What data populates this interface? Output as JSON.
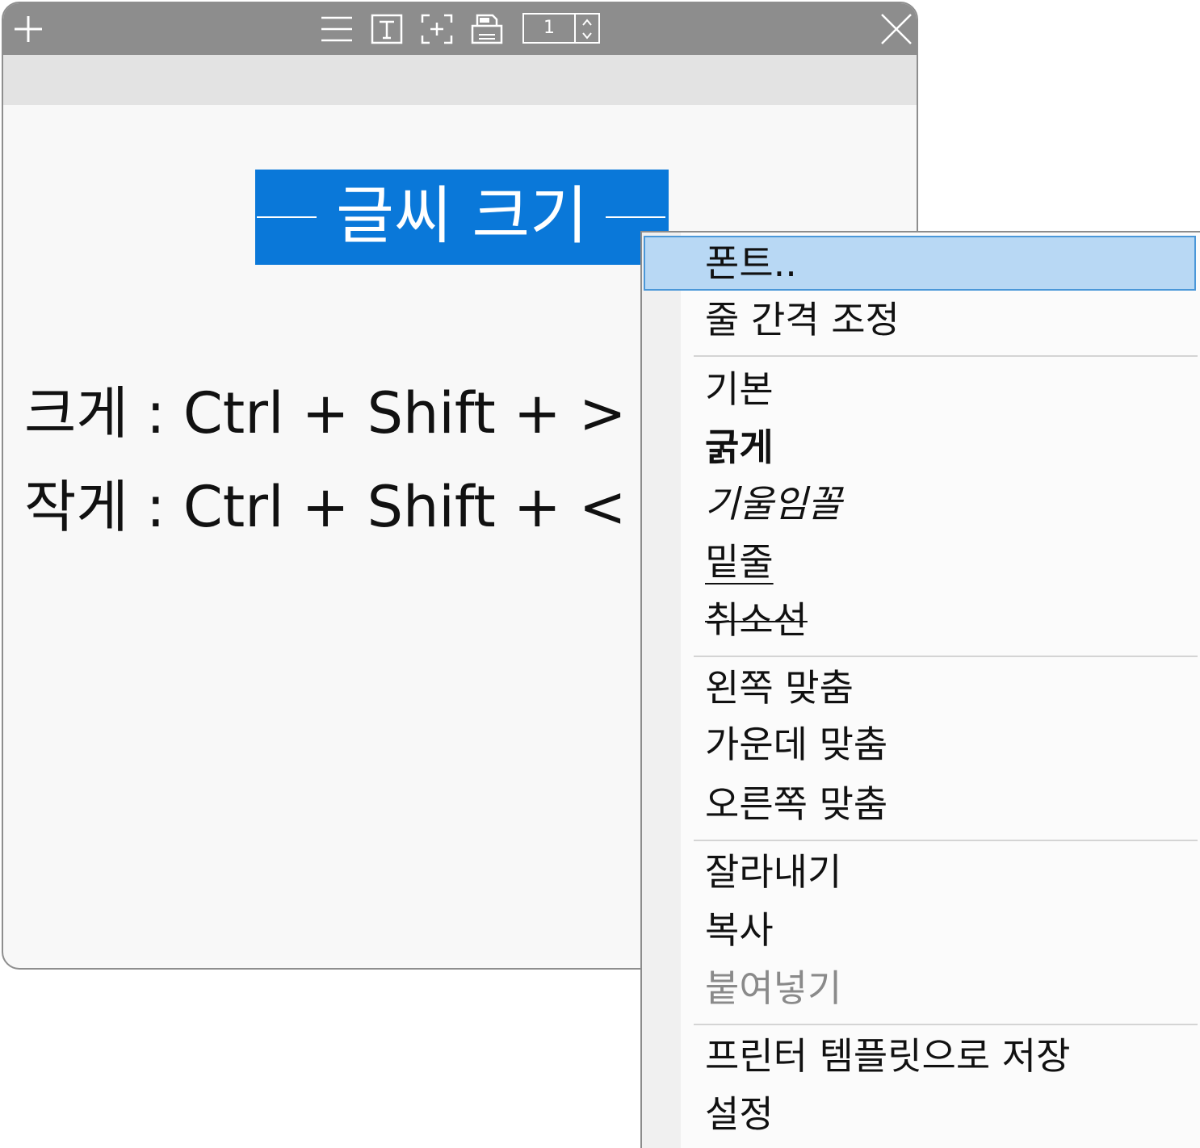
{
  "window": {
    "page_number": "1",
    "title_text": "글씨 크기",
    "shortcuts": [
      "크게 : Ctrl + Shift + >",
      "작게 : Ctrl + Shift + <"
    ]
  },
  "toolbar": {
    "icons": [
      "add-icon",
      "menu-icon",
      "text-icon",
      "capture-icon",
      "print-icon",
      "close-icon"
    ]
  },
  "context_menu": {
    "items": [
      {
        "label": "폰트..",
        "state": "highlighted"
      },
      {
        "label": "줄 간격 조정"
      },
      {
        "label": "기본"
      },
      {
        "label": "굵게",
        "style": "bold"
      },
      {
        "label": "기울임꼴",
        "style": "italic"
      },
      {
        "label": "밑줄",
        "style": "underline"
      },
      {
        "label": "취소선",
        "style": "strikethrough"
      },
      {
        "label": "왼쪽 맞춤"
      },
      {
        "label": "가운데 맞춤"
      },
      {
        "label": "오른쪽 맞춤"
      },
      {
        "label": "잘라내기"
      },
      {
        "label": "복사"
      },
      {
        "label": "붙여넣기",
        "state": "disabled"
      },
      {
        "label": "프린터 템플릿으로 저장"
      },
      {
        "label": "설정"
      }
    ]
  },
  "colors": {
    "titlebar": "#8d8d8d",
    "accent": "#0a78d9",
    "menu_highlight": "#b8d8f4",
    "menu_highlight_border": "#4a97d8",
    "disabled_text": "#8a8a8a"
  }
}
